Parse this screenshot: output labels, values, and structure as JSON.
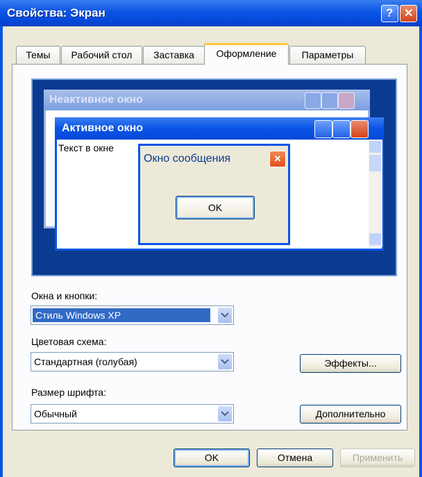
{
  "window": {
    "title": "Свойства: Экран",
    "help_label": "?",
    "close_label": "✕"
  },
  "tabs": [
    {
      "label": "Темы"
    },
    {
      "label": "Рабочий стол"
    },
    {
      "label": "Заставка"
    },
    {
      "label": "Оформление"
    },
    {
      "label": "Параметры"
    }
  ],
  "preview": {
    "inactive_title": "Неактивное окно",
    "active_title": "Активное окно",
    "window_text": "Текст в окне",
    "message_title": "Окно сообщения",
    "message_ok": "OK"
  },
  "fields": {
    "windows_buttons": {
      "label": "Окна и кнопки:",
      "value": "Стиль Windows XP"
    },
    "color_scheme": {
      "label": "Цветовая схема:",
      "value": "Стандартная (голубая)"
    },
    "font_size": {
      "label": "Размер шрифта:",
      "value": "Обычный"
    }
  },
  "buttons": {
    "effects": "Эффекты...",
    "advanced": "Дополнительно",
    "ok": "OK",
    "cancel": "Отмена",
    "apply": "Применить"
  },
  "colors": {
    "titlebar": "#0a54e6",
    "dialog_bg": "#ece9d8",
    "preview_bg": "#0a3b91",
    "selection": "#316ac5",
    "close_red": "#d4421c"
  }
}
